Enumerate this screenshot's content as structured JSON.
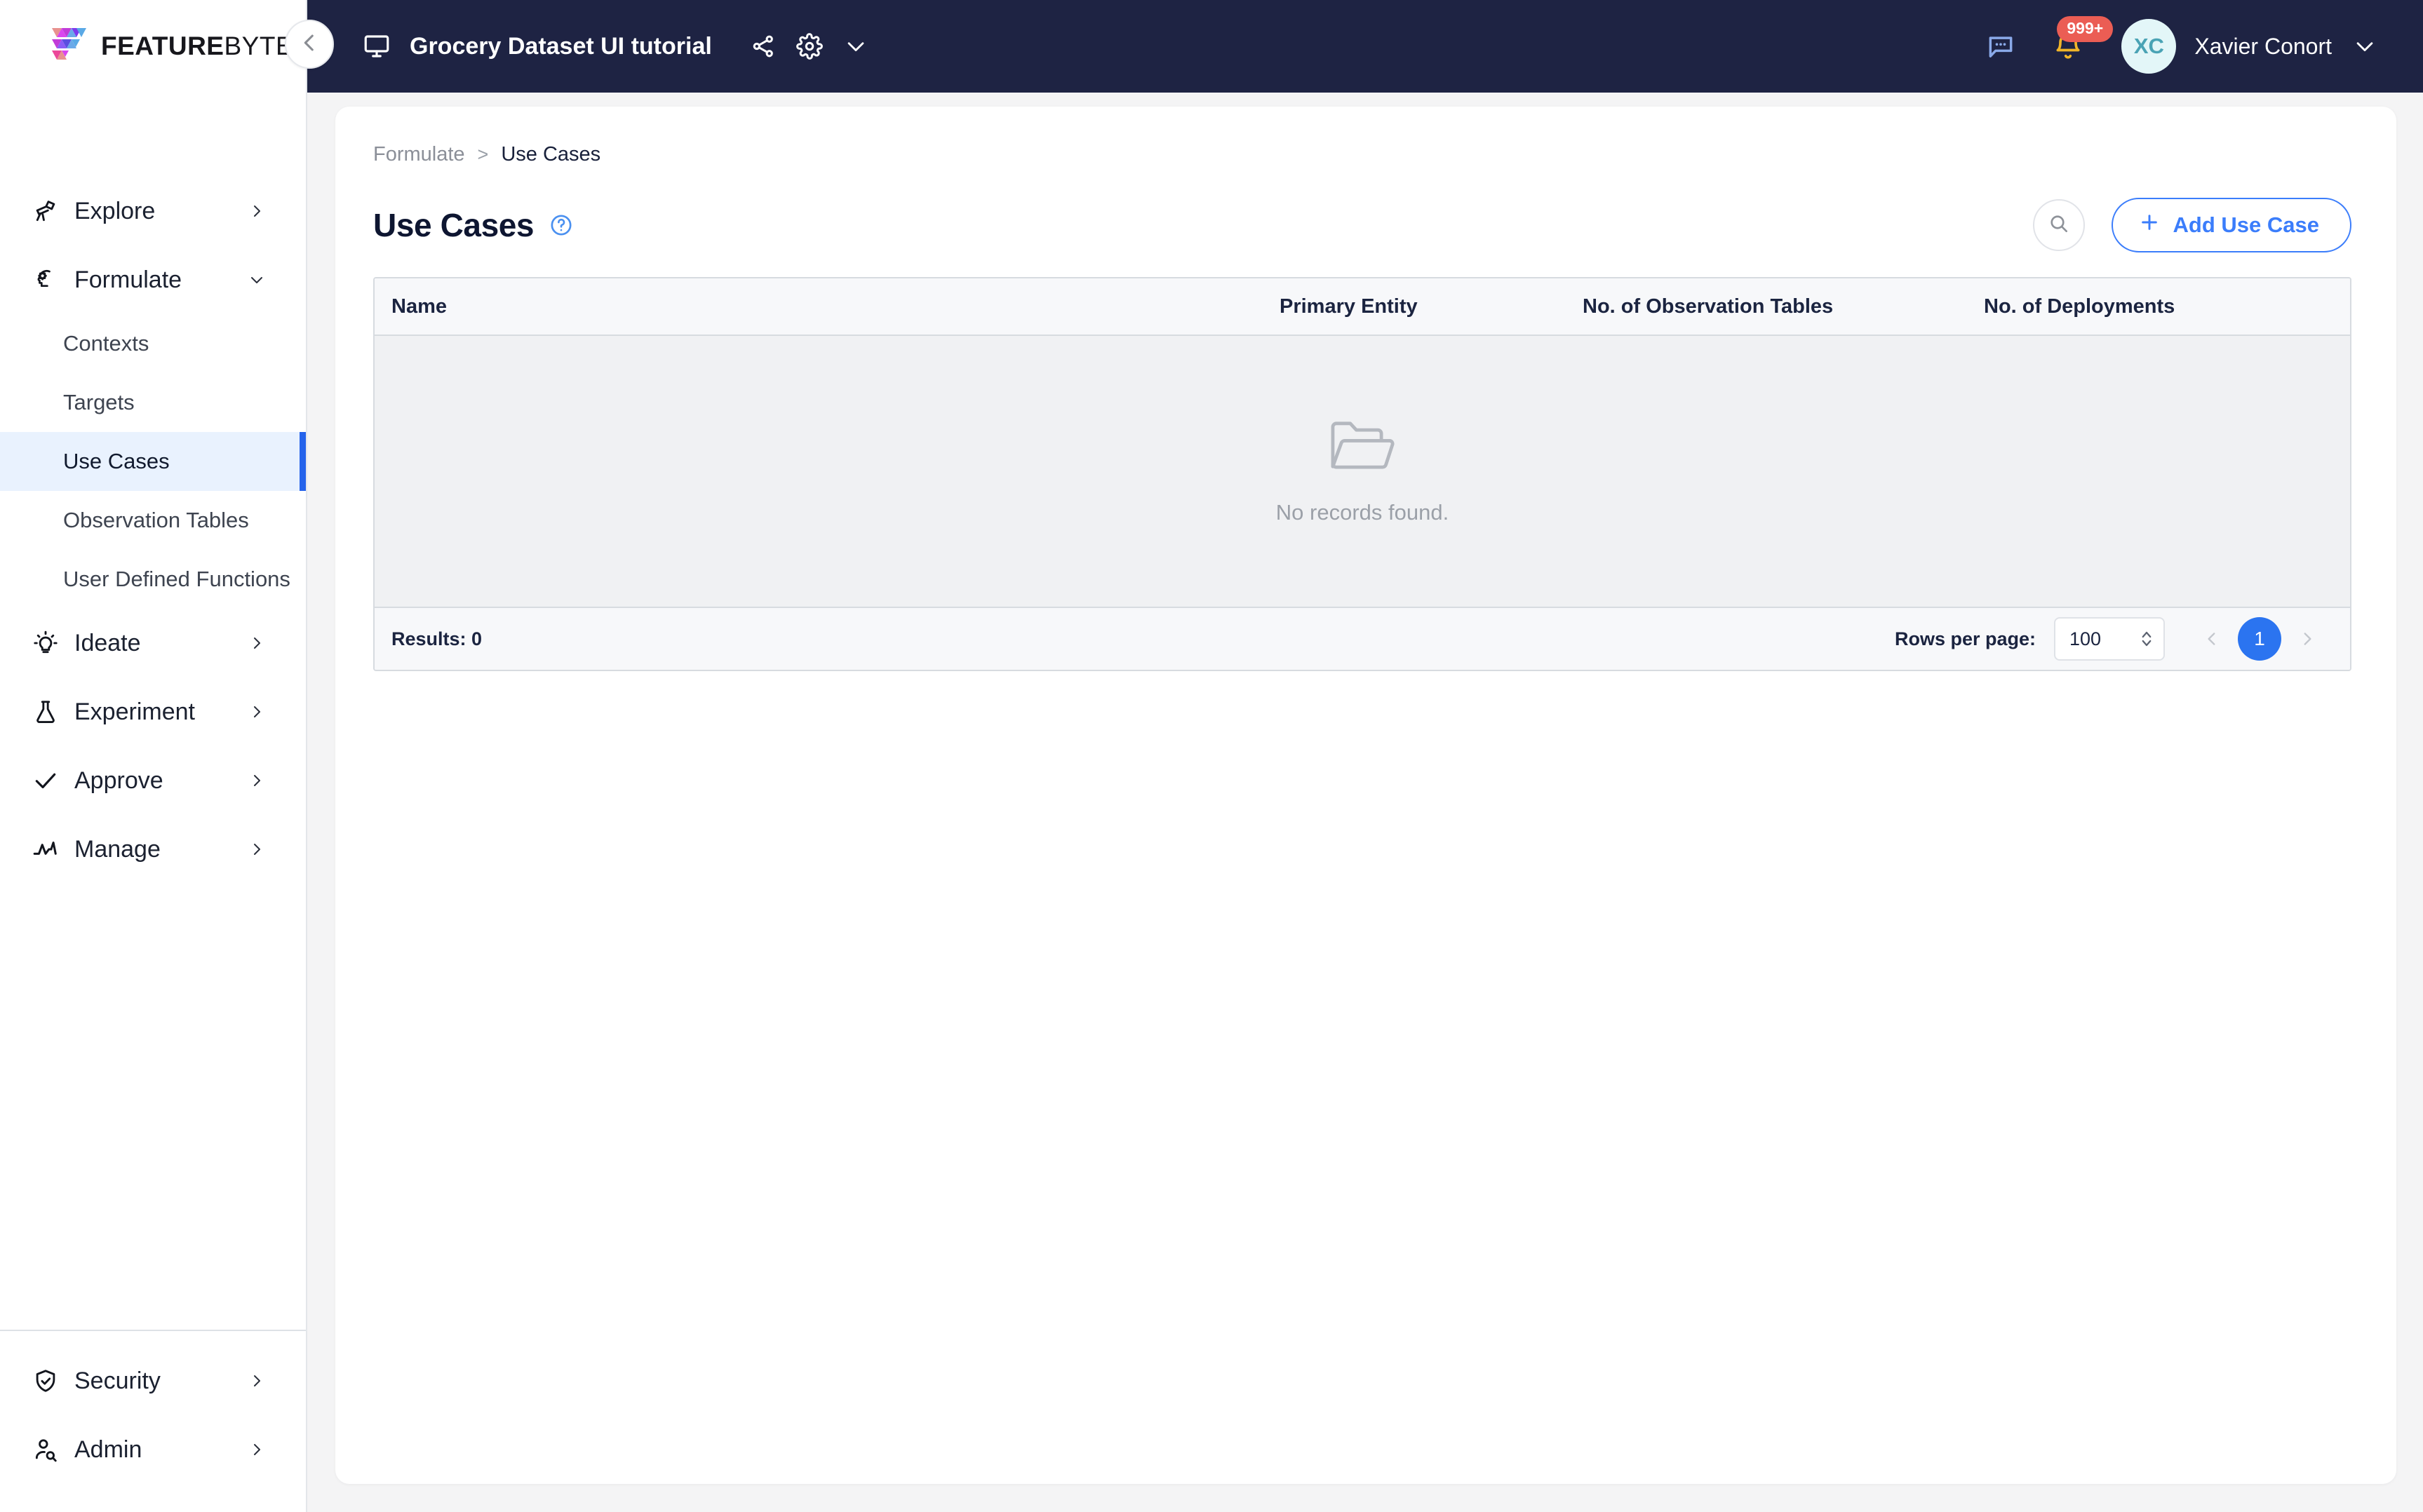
{
  "brand": {
    "name_bold": "FEATURE",
    "name_light": "BYTE",
    "logo_colors": [
      "#e8918f",
      "#c13bd8",
      "#7c3aed",
      "#5aa9e6",
      "#d946ef",
      "#8b5cf6",
      "#6aa9e9",
      "#ec4899",
      "#e8918f"
    ]
  },
  "header": {
    "workspace_title": "Grocery Dataset UI tutorial",
    "monitor_icon": "monitor-icon",
    "share_icon": "share-icon",
    "settings_icon": "gear-icon",
    "header_chevron_icon": "chevron-down-icon",
    "chat_icon": "chat-bubble-icon",
    "bell_icon": "bell-icon",
    "notification_count": "999+",
    "notification_badge_color": "#eb5d54",
    "avatar_initials": "XC",
    "avatar_bg": "#e3f6f8",
    "avatar_fg": "#4aa3b5",
    "user_name": "Xavier Conort",
    "user_chevron_icon": "chevron-down-icon",
    "background_color": "#1e2343"
  },
  "collapse_button": {
    "icon": "chevron-left-icon"
  },
  "sidebar": {
    "items": [
      {
        "label": "Explore",
        "icon": "telescope-icon",
        "chevron": "chevron-right-icon",
        "expanded": false
      },
      {
        "label": "Formulate",
        "icon": "brain-gear-icon",
        "chevron": "chevron-down-icon",
        "expanded": true
      },
      {
        "label": "Ideate",
        "icon": "lightbulb-icon",
        "chevron": "chevron-right-icon",
        "expanded": false
      },
      {
        "label": "Experiment",
        "icon": "flask-icon",
        "chevron": "chevron-right-icon",
        "expanded": false
      },
      {
        "label": "Approve",
        "icon": "check-icon",
        "chevron": "chevron-right-icon",
        "expanded": false
      },
      {
        "label": "Manage",
        "icon": "activity-pulse-icon",
        "chevron": "chevron-right-icon",
        "expanded": false
      }
    ],
    "formulate_children": [
      {
        "label": "Contexts",
        "active": false
      },
      {
        "label": "Targets",
        "active": false
      },
      {
        "label": "Use Cases",
        "active": true
      },
      {
        "label": "Observation Tables",
        "active": false
      },
      {
        "label": "User Defined Functions",
        "active": false
      }
    ],
    "bottom_items": [
      {
        "label": "Security",
        "icon": "shield-check-icon",
        "chevron": "chevron-right-icon"
      },
      {
        "label": "Admin",
        "icon": "user-search-icon",
        "chevron": "chevron-right-icon"
      }
    ],
    "active_accent_color": "#2563eb",
    "active_bg_color": "#e9f2fe"
  },
  "main": {
    "breadcrumb": {
      "parent": "Formulate",
      "separator": ">",
      "current": "Use Cases"
    },
    "page_title": "Use Cases",
    "help_icon": "question-circle-icon",
    "search_icon": "search-icon",
    "add_button": {
      "label": "Add Use Case",
      "icon": "plus-icon",
      "color": "#3b7dfb"
    },
    "table": {
      "columns": [
        "Name",
        "Primary Entity",
        "No. of Observation Tables",
        "No. of Deployments"
      ],
      "rows": [],
      "empty_icon": "open-folder-icon",
      "empty_message": "No records found."
    },
    "footer": {
      "results_label": "Results: 0",
      "rows_per_page_label": "Rows per page:",
      "rows_per_page_value": "100",
      "rows_per_page_stepper_icon": "stepper-updown-icon",
      "prev_icon": "chevron-left-icon",
      "next_icon": "chevron-right-icon",
      "current_page": "1",
      "current_page_color": "#2b74f0"
    }
  }
}
